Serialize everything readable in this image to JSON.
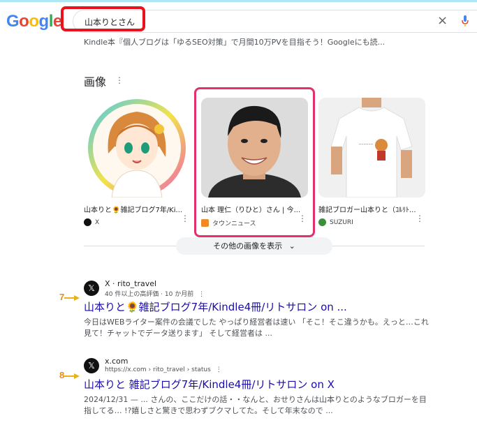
{
  "header": {
    "logo_text": "Google",
    "logo_colors": [
      "#4285f4",
      "#ea4335",
      "#fbbc05",
      "#4285f4",
      "#34a853",
      "#ea4335"
    ],
    "search_query": "山本りとさん",
    "clear_icon": "close-icon",
    "mic_icon": "microphone-icon"
  },
  "top_snippet": "Kindle本『個人ブログは「ゆるSEO対策」で月間10万PVを目指そう！Googleにも読...",
  "images_section": {
    "title": "画像",
    "more_icon": "vertical-dots-icon",
    "cards": [
      {
        "caption": "山本りと🌻雑記ブログ7年/Ki...",
        "source": "X",
        "source_color": "#111111"
      },
      {
        "caption": "山本 理仁（りひと）さん | 今...",
        "source": "タウンニュース",
        "source_color": "#f08a24"
      },
      {
        "caption": "雑記ブロガー山本りと（ｺﾙﾘﾄ...",
        "source": "SUZURI",
        "source_color": "#3a8f3a"
      }
    ],
    "more_button": "その他の画像を表示"
  },
  "results": [
    {
      "annotation": "7",
      "site": "X · rito_travel",
      "meta": "40 件以上の高評価 · 10 か月前",
      "title": "山本りと🌻雑記ブログ7年/Kindle4冊/リトサロン on ...",
      "snippet": "今日はWEBライター案件の会議でした やっぱり経営者は速い 「そこ！そこ違うかも。えっと…これ見て！チャットでデータ送ります」 そして経営者は ..."
    },
    {
      "annotation": "8",
      "site": "x.com",
      "meta": "https://x.com › rito_travel › status",
      "title": "山本りと 雑記ブログ7年/Kindle4冊/リトサロン on X",
      "snippet": "2024/12/31 — ... さんの、ここだけの話・・なんと、おせりさんは山本りとのようなブロガーを目指してる… !?嬉しさと驚きで思わずブクマしてた。そして年末なので ..."
    }
  ],
  "colors": {
    "search_highlight": "#e8131c",
    "card_highlight": "#e2306c",
    "link": "#1a0dab",
    "annotation": "#e88a1a"
  }
}
